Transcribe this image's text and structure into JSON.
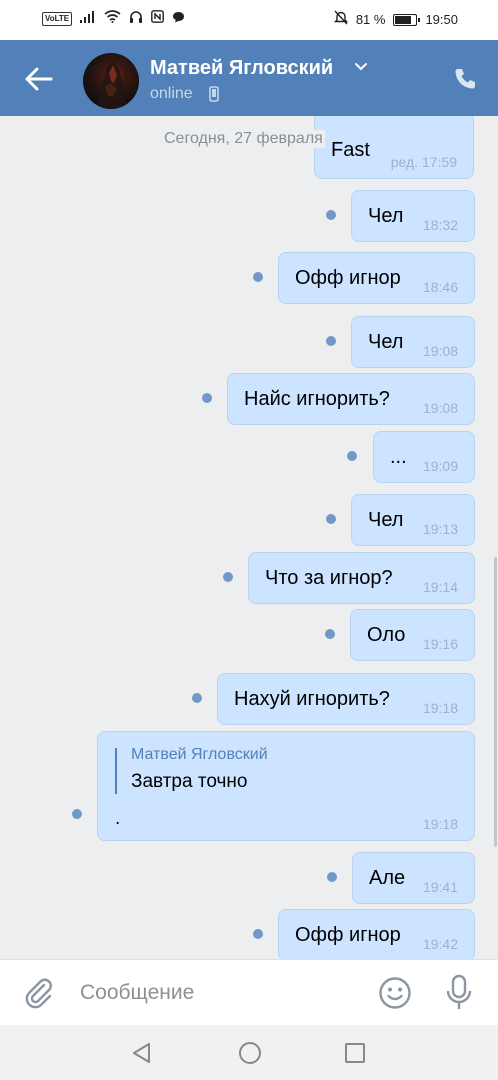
{
  "status_bar": {
    "volte": "VoLTE",
    "battery_text": "81 %",
    "battery_level": 0.81,
    "time": "19:50"
  },
  "header": {
    "contact_name": "Матвей Ягловский",
    "status": "online",
    "background_color": "#5181b8"
  },
  "chat": {
    "date_divider": "Сегодня, 27 февраля",
    "messages": [
      {
        "text": "Fast",
        "time": "ред. 17:59"
      },
      {
        "text": "Чел",
        "time": "18:32"
      },
      {
        "text": "Офф игнор",
        "time": "18:46"
      },
      {
        "text": "Чел",
        "time": "19:08"
      },
      {
        "text": "Найс игнорить?",
        "time": "19:08"
      },
      {
        "text": "...",
        "time": "19:09"
      },
      {
        "text": "Чел",
        "time": "19:13"
      },
      {
        "text": "Что за игнор?",
        "time": "19:14"
      },
      {
        "text": "Оло",
        "time": "19:16"
      },
      {
        "text": "Нахуй игнорить?",
        "time": "19:18"
      },
      {
        "reply_author": "Матвей Ягловский",
        "reply_text": "Завтра точно",
        "text": ".",
        "time": "19:18"
      },
      {
        "text": "Але",
        "time": "19:41"
      },
      {
        "text": "Офф игнор",
        "time": "19:42"
      }
    ]
  },
  "composer": {
    "placeholder": "Сообщение"
  },
  "icons": {
    "back": "arrow-left-icon",
    "call": "phone-icon",
    "attach": "paperclip-icon",
    "emoji": "smile-icon",
    "mic": "microphone-icon"
  }
}
